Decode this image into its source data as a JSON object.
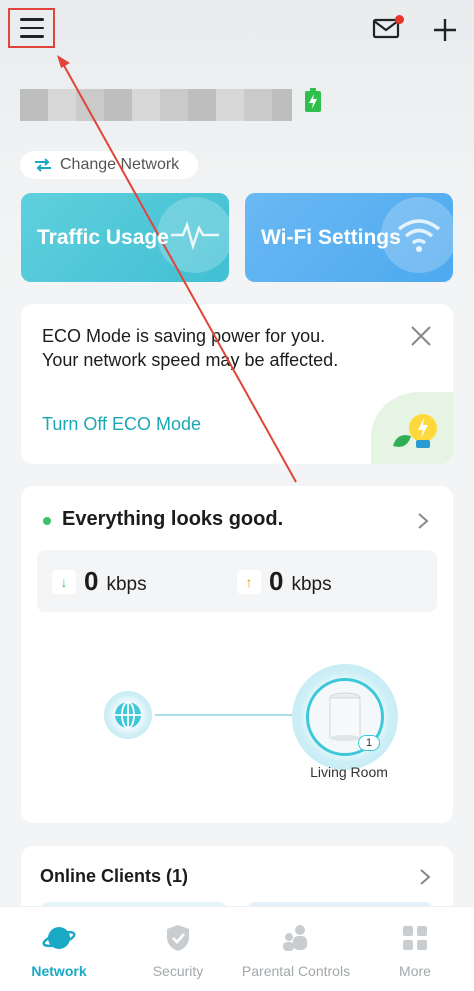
{
  "header": {
    "menu_icon": "hamburger-menu-icon",
    "mail_icon": "mail-icon",
    "add_icon": "plus-icon",
    "battery_icon": "battery-charging-icon"
  },
  "network": {
    "change_network_label": "Change Network"
  },
  "tiles": {
    "traffic_label": "Traffic Usage",
    "wifi_label": "Wi-Fi Settings"
  },
  "eco": {
    "message": "ECO Mode is saving power for you. Your network speed may be affected.",
    "link_label": "Turn Off ECO Mode"
  },
  "status": {
    "title": "Everything looks good.",
    "download_value": "0",
    "download_unit": "kbps",
    "upload_value": "0",
    "upload_unit": "kbps",
    "router_name": "Living Room",
    "router_badge": "1"
  },
  "clients": {
    "title": "Online Clients (1)"
  },
  "nav": {
    "items": [
      {
        "label": "Network",
        "icon": "planet-icon",
        "active": true
      },
      {
        "label": "Security",
        "icon": "shield-icon",
        "active": false
      },
      {
        "label": "Parental Controls",
        "icon": "family-icon",
        "active": false
      },
      {
        "label": "More",
        "icon": "grid-icon",
        "active": false
      }
    ]
  },
  "colors": {
    "accent": "#1aa9c4",
    "traffic_tile": "#4cc6d8",
    "wifi_tile": "#5aaff1",
    "status_ok": "#3cc36a",
    "annotation": "#e0443a"
  }
}
